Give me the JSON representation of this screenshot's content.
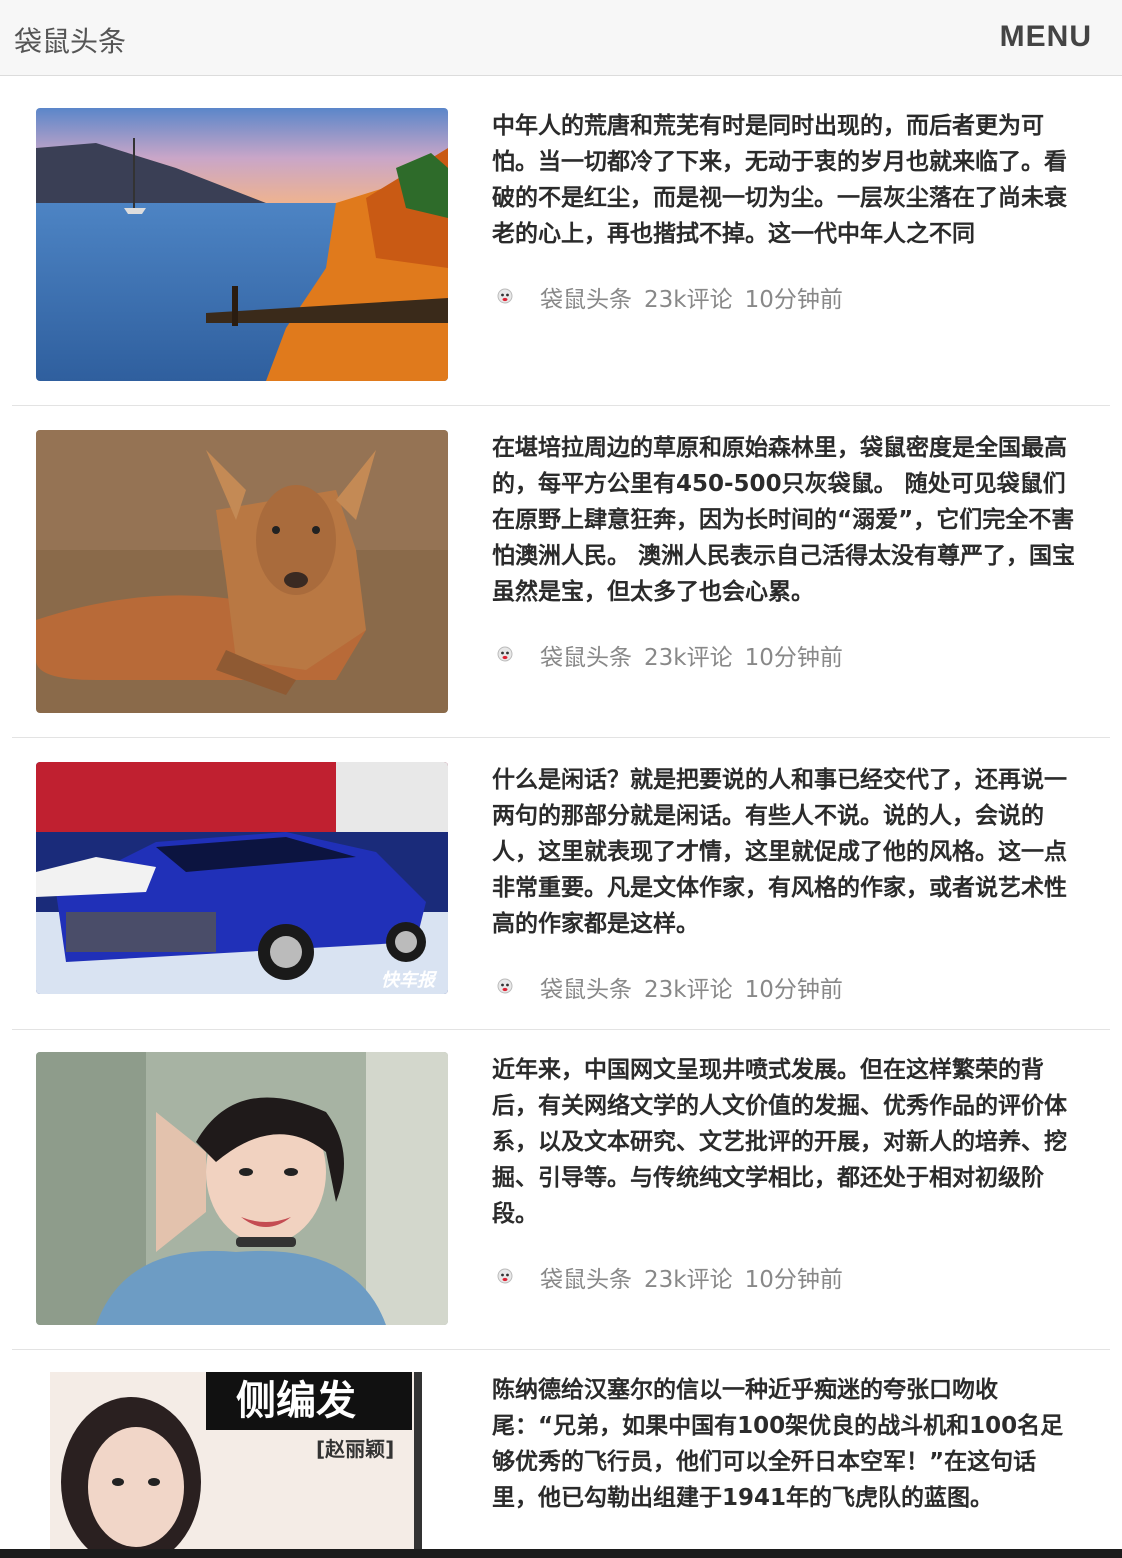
{
  "header": {
    "brand": "袋鼠头条",
    "menu_label": "MENU"
  },
  "articles": [
    {
      "title": "中年人的荒唐和荒芜有时是同时出现的，而后者更为可怕。当一切都冷了下来，无动于衷的岁月也就来临了。看破的不是红尘，而是视一切为尘。一层灰尘落在了尚未衰老的心上，再也揩拭不掉。这一代中年人之不同",
      "source": "袋鼠头条",
      "comments": "23k评论",
      "time": "10分钟前"
    },
    {
      "title": "在堪培拉周边的草原和原始森林里，袋鼠密度是全国最高的，每平方公里有450-500只灰袋鼠。 随处可见袋鼠们在原野上肆意狂奔，因为长时间的“溺爱”，它们完全不害怕澳洲人民。 澳洲人民表示自己活得太没有尊严了，国宝虽然是宝，但太多了也会心累。",
      "source": "袋鼠头条",
      "comments": "23k评论",
      "time": "10分钟前"
    },
    {
      "title": "什么是闲话？就是把要说的人和事已经交代了，还再说一两句的那部分就是闲话。有些人不说。说的人，会说的人，这里就表现了才情，这里就促成了他的风格。这一点非常重要。凡是文体作家，有风格的作家，或者说艺术性高的作家都是这样。",
      "source": "袋鼠头条",
      "comments": "23k评论",
      "time": "10分钟前",
      "image_text": "快车报"
    },
    {
      "title": "近年来，中国网文呈现井喷式发展。但在这样繁荣的背后，有关网络文学的人文价值的发掘、优秀作品的评价体系，以及文本研究、文艺批评的开展，对新人的培养、挖掘、引导等。与传统纯文学相比，都还处于相对初级阶段。",
      "source": "袋鼠头条",
      "comments": "23k评论",
      "time": "10分钟前"
    },
    {
      "title": "陈纳德给汉塞尔的信以一种近乎痴迷的夸张口吻收尾：“兄弟，如果中国有100架优良的战斗机和100名足够优秀的飞行员，他们可以全歼日本空军！”在这句话里，他已勾勒出组建于1941年的飞虎队的蓝图。",
      "image_text": "侧编发",
      "image_subtext": "[赵丽颖]"
    }
  ]
}
